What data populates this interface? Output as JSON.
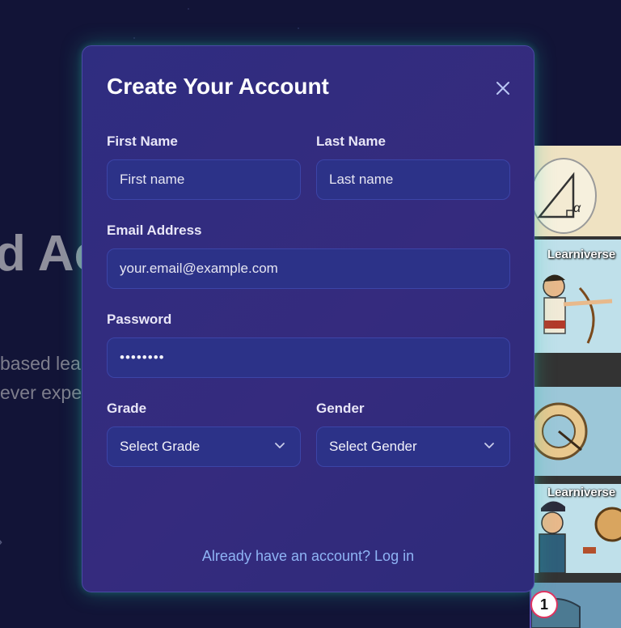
{
  "background": {
    "heading": "d Ac",
    "line1": "based lear",
    "line2": "ever expe",
    "strip_labels": [
      "Learniverse",
      "Learniverse"
    ]
  },
  "modal": {
    "title": "Create Your Account",
    "first_name": {
      "label": "First Name",
      "placeholder": "First name"
    },
    "last_name": {
      "label": "Last Name",
      "placeholder": "Last name"
    },
    "email": {
      "label": "Email Address",
      "placeholder": "your.email@example.com"
    },
    "password": {
      "label": "Password",
      "value": "••••••••"
    },
    "grade": {
      "label": "Grade",
      "selected": "Select Grade"
    },
    "gender": {
      "label": "Gender",
      "selected": "Select Gender"
    },
    "login_link": "Already have an account? Log in"
  },
  "badge_count": "1",
  "colors": {
    "page_bg": "#121437",
    "modal_bg": "#2f2d80",
    "input_bg": "#2c3288",
    "link": "#8fb4f5",
    "glow": "#28c8aa"
  },
  "icons": [
    "close-icon",
    "chevron-down-icon"
  ]
}
